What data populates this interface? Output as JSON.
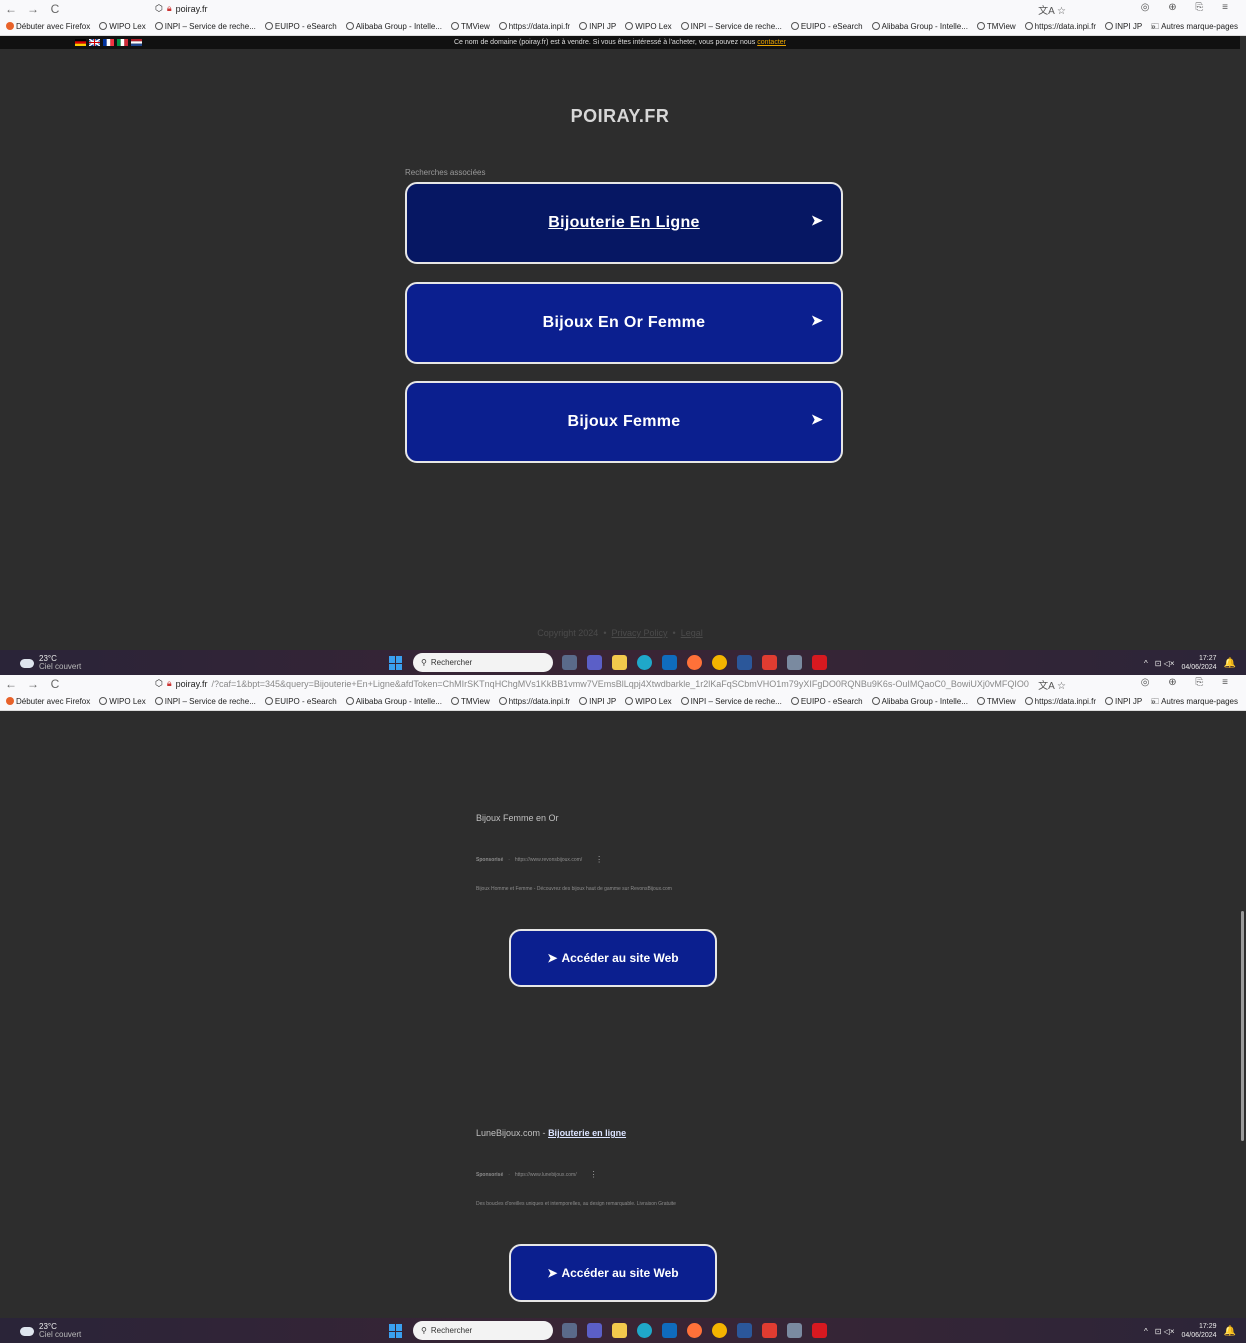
{
  "browser": {
    "nav_back": "←",
    "nav_forward": "→",
    "nav_reload": "C",
    "url_1": "poiray.fr",
    "url_2_host": "poiray.fr",
    "url_2_path": "/?caf=1&bpt=345&query=Bijouterie+En+Ligne&afdToken=ChMIrSKTnqHChgMVs1KkBB1vmw7VEmsBlLqpj4Xtwdbarkle_1r2lKaFqSCbmVHO1m79yXIFgDO0RQNBu9K6s-OuIMQaoC0_BowiUXj0vMFQIO0",
    "translate_icon": "文A",
    "star_icon": "☆",
    "tools": "◎ ⊕ ⎘ ≡",
    "bookmarks": [
      "Débuter avec Firefox",
      "WIPO Lex",
      "INPI – Service de reche...",
      "EUIPO - eSearch",
      "Alibaba Group - Intelle...",
      "TMView",
      "https://data.inpi.fr",
      "INPI JP",
      "WIPO Lex",
      "INPI – Service de reche...",
      "EUIPO - eSearch",
      "Alibaba Group - Intelle...",
      "TMView",
      "https://data.inpi.fr",
      "INPI JP"
    ],
    "bookmarks_more": "»",
    "other_bookmarks": "Autres marque-pages"
  },
  "page1": {
    "banner_text": "Ce nom de domaine (poiray.fr) est à vendre. Si vous êtes intéressé à l'acheter, vous pouvez nous",
    "banner_link": "contacter",
    "title": "POIRAY.FR",
    "related_label": "Recherches associées",
    "buttons": [
      {
        "label": "Bijouterie En Ligne",
        "arrow": "➤"
      },
      {
        "label": "Bijoux En Or Femme",
        "arrow": "➤"
      },
      {
        "label": "Bijoux Femme",
        "arrow": "➤"
      }
    ],
    "footer": {
      "copyright": "Copyright 2024",
      "sep": "•",
      "privacy": "Privacy Policy",
      "legal": "Legal"
    }
  },
  "page2": {
    "ads": [
      {
        "title": "Bijoux Femme en Or",
        "title_link": "",
        "sponsored": "Sponsorisé",
        "sep": "·",
        "url": "https://www.revonsbijoux.com/",
        "kebab": "⋮",
        "description": "Bijoux Homme et Femme - Découvrez des bijoux haut de gamme sur RevonsBijoux.com",
        "button": "Accéder au site Web",
        "button_arrow": "➤"
      },
      {
        "title": "LuneBijoux.com -",
        "title_link": "Bijouterie en ligne",
        "sponsored": "Sponsorisé",
        "sep": "·",
        "url": "https://www.lunebijoux.com/",
        "kebab": "⋮",
        "description": "Des boucles d'oreilles uniques et intemporelles, au design remarquable. Livraison Gratuite",
        "button": "Accéder au site Web",
        "button_arrow": "➤"
      }
    ]
  },
  "taskbar": {
    "temp": "23°C",
    "weather": "Ciel couvert",
    "search": "Rechercher",
    "tray_chevron": "^",
    "tray_icons": "⊡ ◁×",
    "time_1": "17:27",
    "date_1": "04/06/2024",
    "time_2": "17:29",
    "date_2": "04/06/2024",
    "bell": "🔔"
  },
  "colors": {
    "page_bg": "#2d2d2d",
    "button_dark": "#061763",
    "button_blue": "#0b1f8f",
    "banner_link": "#e8a300"
  }
}
